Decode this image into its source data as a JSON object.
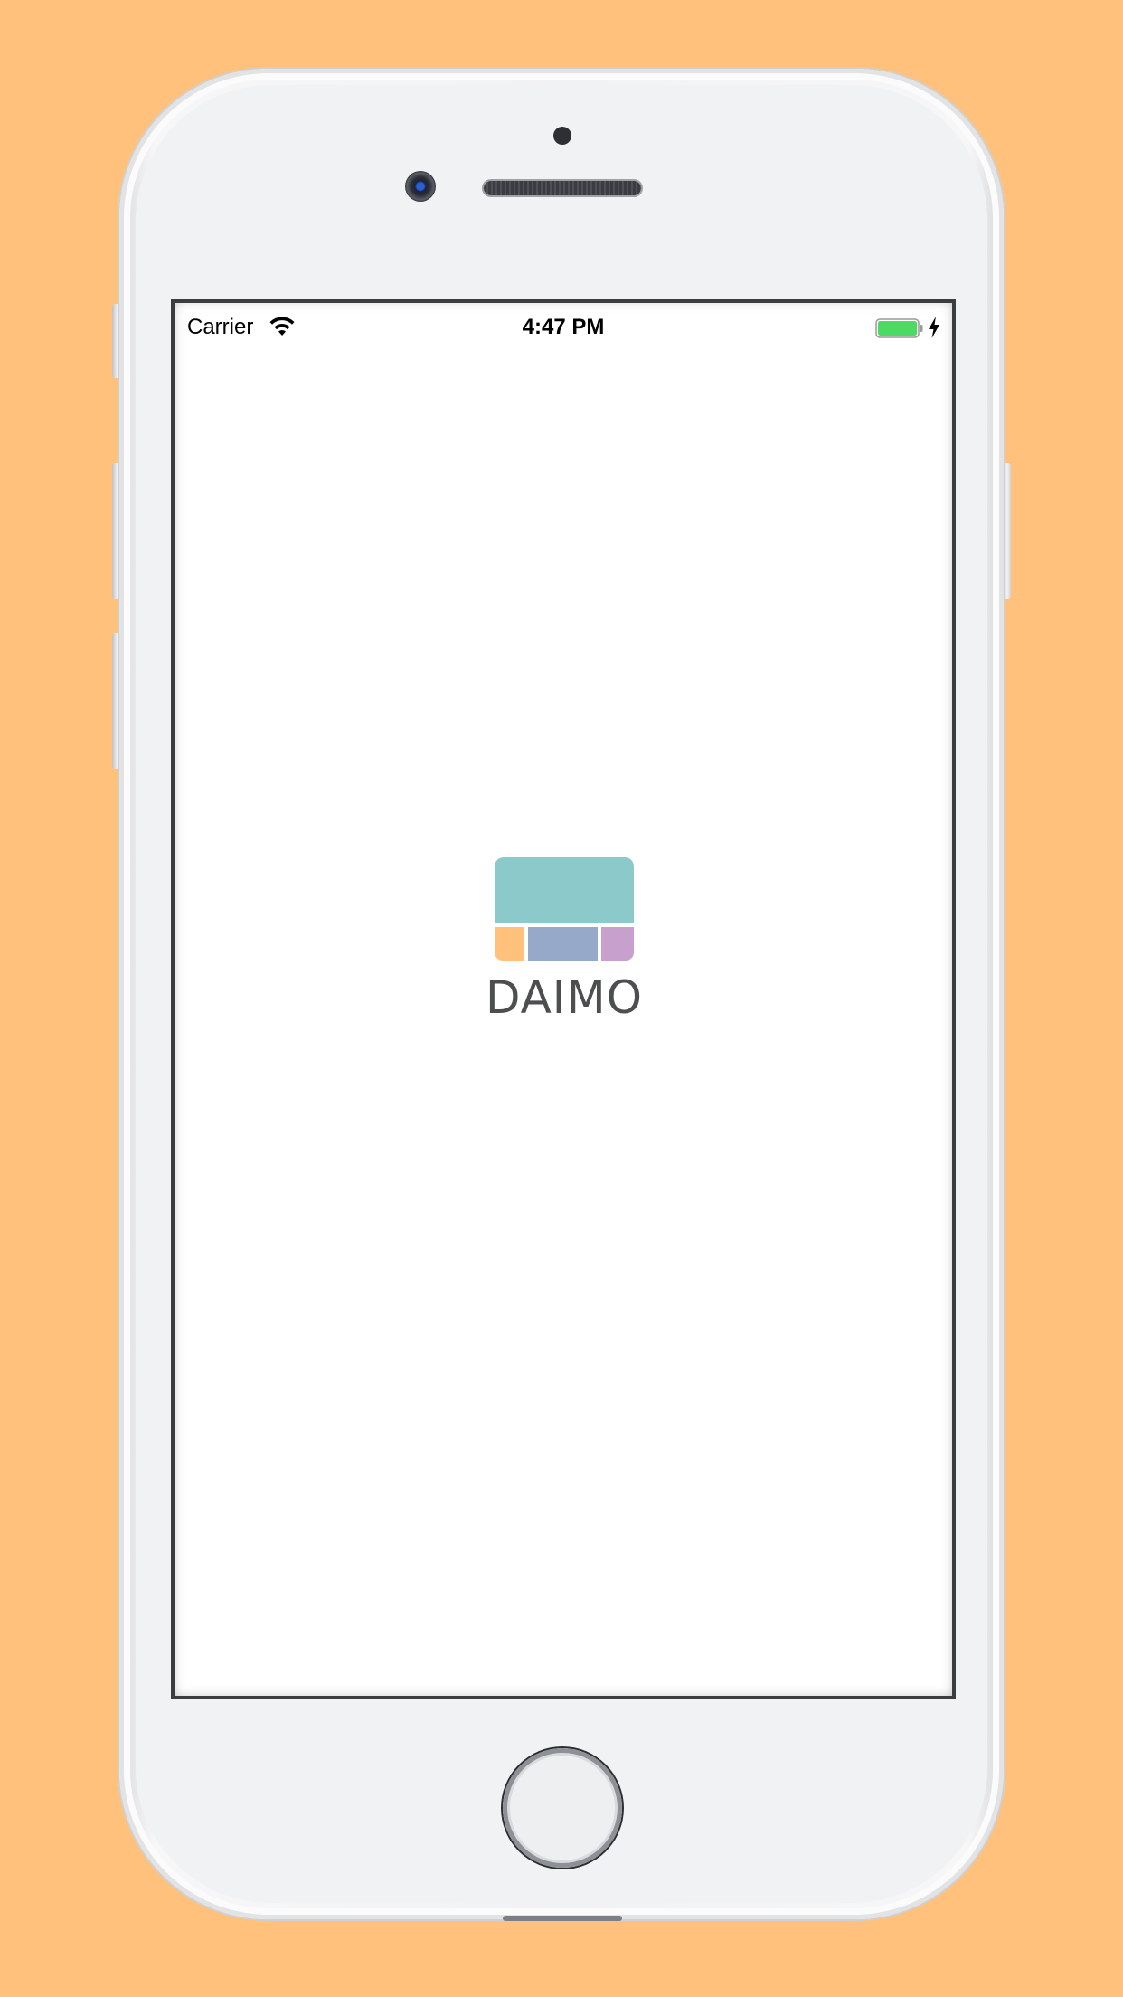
{
  "status_bar": {
    "carrier": "Carrier",
    "time": "4:47 PM",
    "wifi_icon": "wifi-icon",
    "battery_icon": "battery-full-icon",
    "charging_icon": "charging-bolt-icon",
    "battery_color": "#4CD964"
  },
  "splash": {
    "app_name": "DAIMO",
    "logo_colors": {
      "top": "#8CC9CB",
      "bottom_left": "#FFC17C",
      "bottom_middle": "#97A9C8",
      "bottom_right": "#C8A0CE"
    }
  },
  "device": {
    "background_color": "#FFC17C"
  }
}
